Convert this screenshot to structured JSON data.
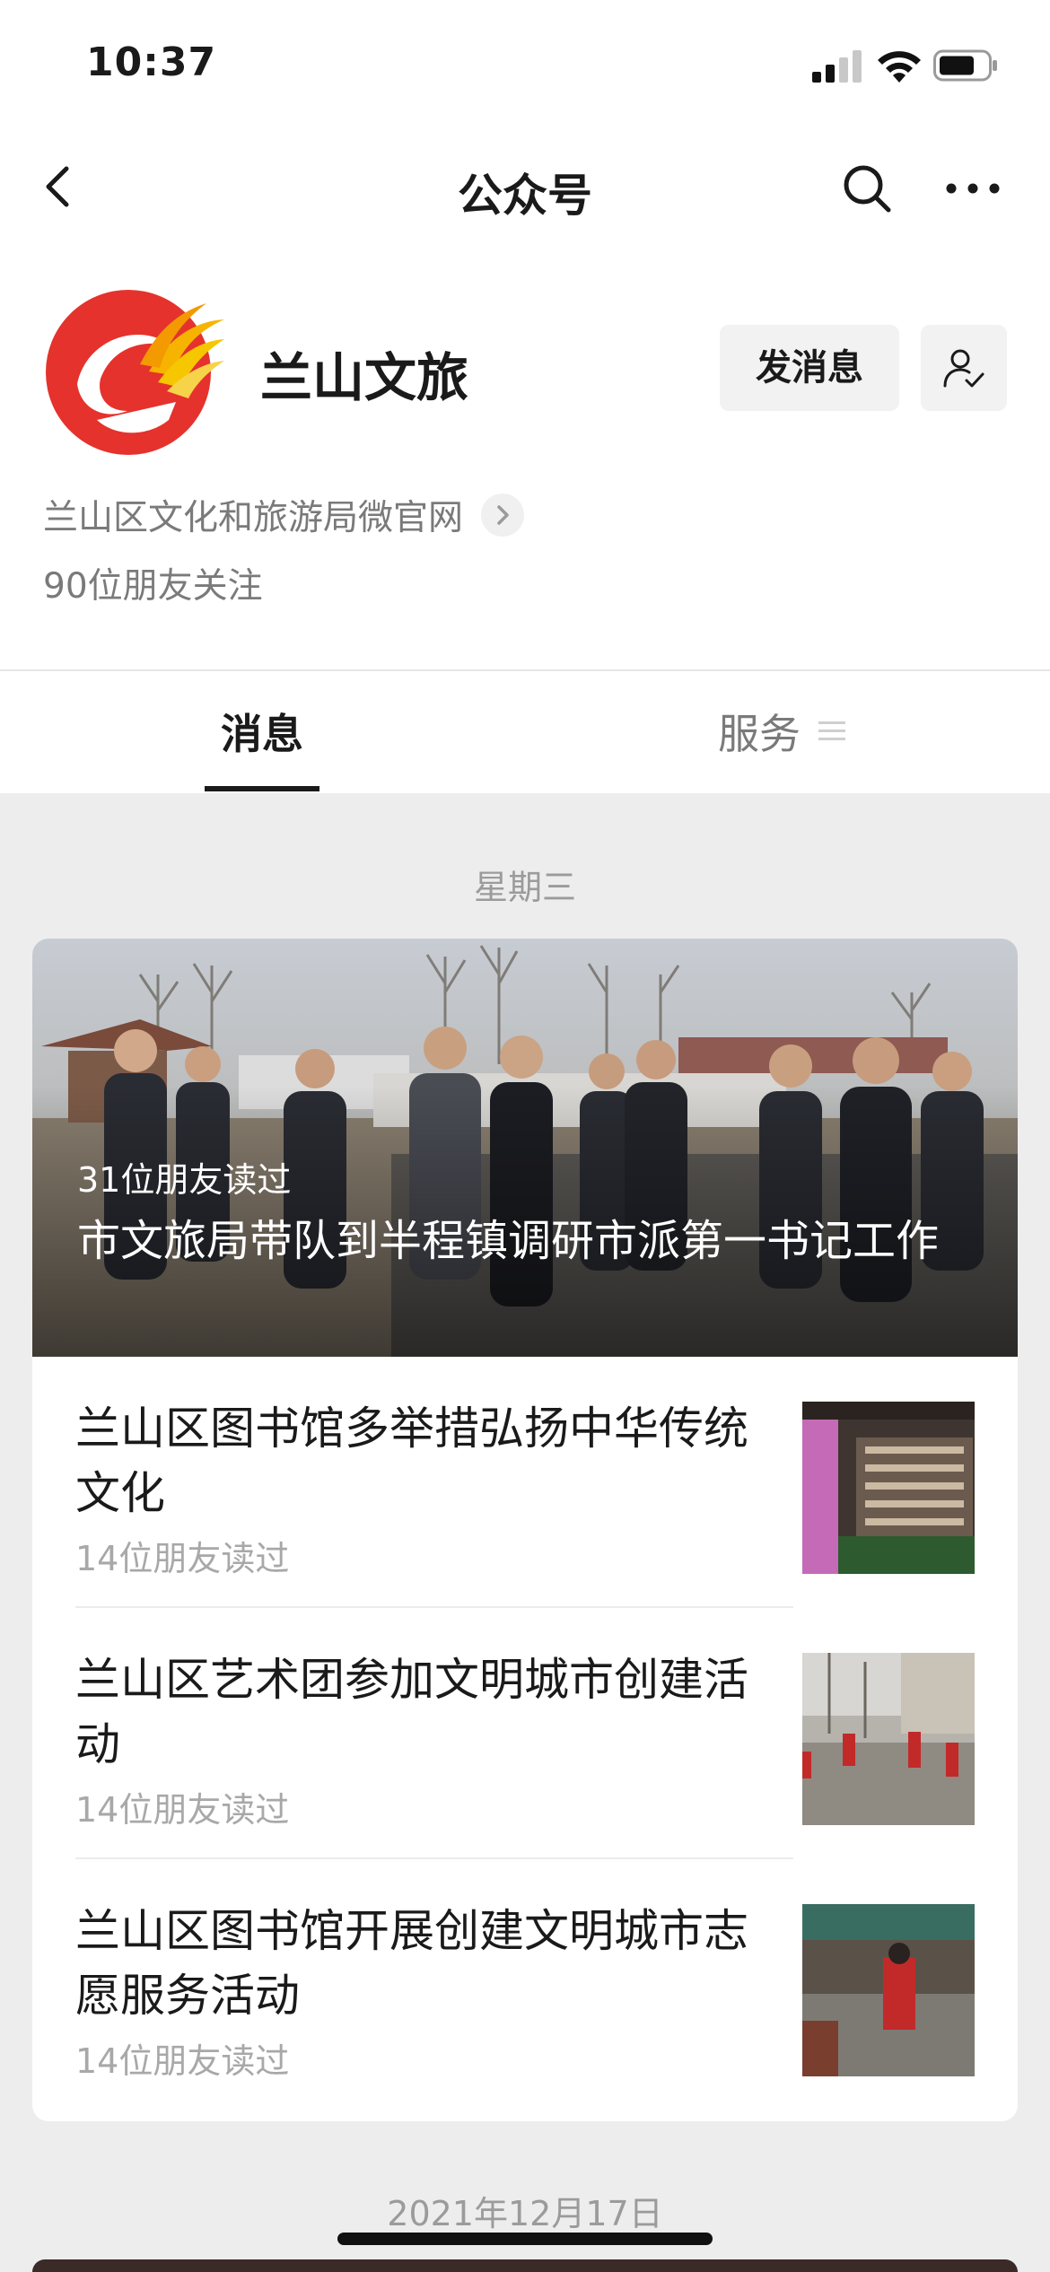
{
  "status_bar": {
    "time": "10:37"
  },
  "nav": {
    "title": "公众号",
    "icons": [
      "back-chevron-icon",
      "search-icon",
      "more-icon"
    ]
  },
  "account": {
    "name": "兰山文旅",
    "description": "兰山区文化和旅游局微官网",
    "followers": "90位朋友关注",
    "message_button": "发消息",
    "logo_colors": [
      "#e5322d",
      "#f2b200"
    ]
  },
  "tabs": [
    {
      "label": "消息",
      "selected": true
    },
    {
      "label": "服务",
      "selected": false
    }
  ],
  "feed": {
    "groups": [
      {
        "date": "星期三",
        "cover_article": {
          "reads": "31位朋友读过",
          "title": "市文旅局带队到半程镇调研市派第一书记工作"
        },
        "articles": [
          {
            "title": "兰山区图书馆多举措弘扬中华传统文化",
            "reads": "14位朋友读过"
          },
          {
            "title": "兰山区艺术团参加文明城市创建活动",
            "reads": "14位朋友读过"
          },
          {
            "title": "兰山区图书馆开展创建文明城市志愿服务活动",
            "reads": "14位朋友读过"
          }
        ]
      },
      {
        "date": "2021年12月17日"
      }
    ]
  }
}
